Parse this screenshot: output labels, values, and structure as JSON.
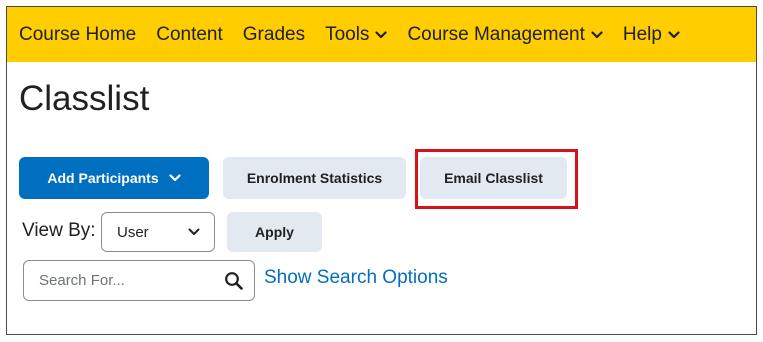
{
  "navbar": {
    "items": [
      {
        "label": "Course Home",
        "dropdown": false
      },
      {
        "label": "Content",
        "dropdown": false
      },
      {
        "label": "Grades",
        "dropdown": false
      },
      {
        "label": "Tools",
        "dropdown": true
      },
      {
        "label": "Course Management",
        "dropdown": true
      },
      {
        "label": "Help",
        "dropdown": true
      }
    ],
    "background": "#ffcd00"
  },
  "page": {
    "title": "Classlist"
  },
  "actions": {
    "add_participants": "Add Participants",
    "enrolment_statistics": "Enrolment Statistics",
    "email_classlist": "Email Classlist"
  },
  "view_by": {
    "label": "View By:",
    "selected": "User",
    "apply": "Apply"
  },
  "search": {
    "placeholder": "Search For...",
    "options_link": "Show Search Options"
  },
  "colors": {
    "primary": "#006fbf",
    "secondary": "#e3e9f1",
    "highlight": "#d4141d"
  },
  "icons": [
    "chevron-down-icon",
    "search-icon"
  ]
}
